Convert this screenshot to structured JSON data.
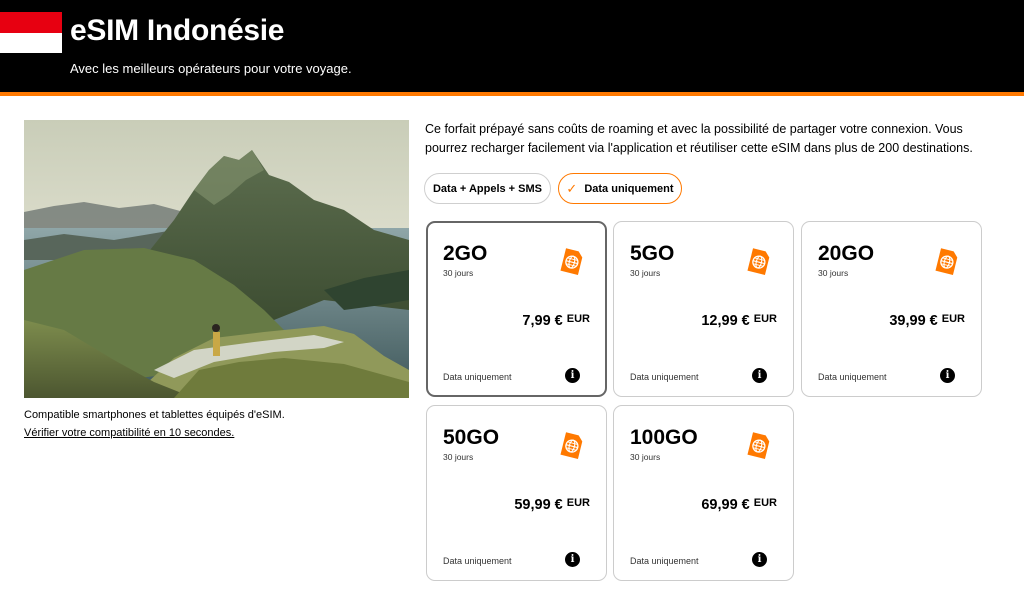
{
  "header": {
    "title": "eSIM Indonésie",
    "subtitle": "Avec les meilleurs opérateurs pour votre voyage.",
    "flag_colors": {
      "top": "#e70011",
      "bottom": "#ffffff"
    },
    "accent": "#ff7900"
  },
  "hero": {
    "image": "landscape-photo-indonesia-hills-and-bay",
    "compat_text": "Compatible smartphones et tablettes équipés d'eSIM.",
    "compat_link": "Vérifier votre compatibilité en 10 secondes."
  },
  "description": "Ce forfait prépayé sans coûts de roaming et avec la possibilité de partager votre connexion. Vous pourrez recharger facilement via l'application et réutiliser cette eSIM dans plus de 200 destinations.",
  "filters": [
    {
      "label": "Data + Appels + SMS",
      "active": false
    },
    {
      "label": "Data uniquement",
      "active": true,
      "icon": "checkmark-icon"
    }
  ],
  "plans": [
    {
      "size": "2GO",
      "days": "30 jours",
      "price": "7,99 €",
      "currency": "EUR",
      "type": "Data uniquement",
      "selected": true,
      "icon": "globe-sim-icon"
    },
    {
      "size": "5GO",
      "days": "30 jours",
      "price": "12,99 €",
      "currency": "EUR",
      "type": "Data uniquement",
      "selected": false,
      "icon": "globe-sim-icon"
    },
    {
      "size": "20GO",
      "days": "30 jours",
      "price": "39,99 €",
      "currency": "EUR",
      "type": "Data uniquement",
      "selected": false,
      "icon": "globe-sim-icon"
    },
    {
      "size": "50GO",
      "days": "30 jours",
      "price": "59,99 €",
      "currency": "EUR",
      "type": "Data uniquement",
      "selected": false,
      "icon": "globe-sim-icon"
    },
    {
      "size": "100GO",
      "days": "30 jours",
      "price": "69,99 €",
      "currency": "EUR",
      "type": "Data uniquement",
      "selected": false,
      "icon": "globe-sim-icon"
    }
  ],
  "info_icon_glyph": "i"
}
